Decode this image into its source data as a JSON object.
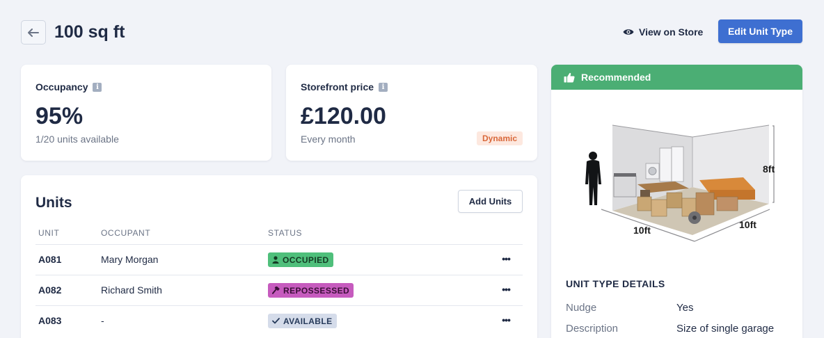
{
  "header": {
    "title": "100 sq ft",
    "view_on_store": "View on Store",
    "edit_button": "Edit Unit Type"
  },
  "occupancy": {
    "label": "Occupancy",
    "value": "95%",
    "sub": "1/20 units available"
  },
  "price": {
    "label": "Storefront price",
    "value": "£120.00",
    "sub": "Every month",
    "badge": "Dynamic"
  },
  "units": {
    "title": "Units",
    "add_button": "Add Units",
    "columns": [
      "UNIT",
      "OCCUPANT",
      "STATUS"
    ],
    "rows": [
      {
        "unit": "A081",
        "occupant": "Mary Morgan",
        "status": "OCCUPIED"
      },
      {
        "unit": "A082",
        "occupant": "Richard Smith",
        "status": "REPOSSESSED"
      },
      {
        "unit": "A083",
        "occupant": "-",
        "status": "AVAILABLE"
      }
    ],
    "more_glyph": "•••"
  },
  "recommended": {
    "header": "Recommended",
    "dims": {
      "height": "8ft",
      "width": "10ft",
      "depth": "10ft"
    },
    "details_title": "UNIT TYPE DETAILS",
    "details": [
      {
        "key": "Nudge",
        "value": "Yes"
      },
      {
        "key": "Description",
        "value": "Size of single garage"
      }
    ]
  },
  "colors": {
    "primary": "#3e6fd1",
    "recommended": "#4bae74",
    "occupied": "#4fbf7b",
    "repossessed": "#c65bbe",
    "available": "#d5dcea",
    "dynamic_badge_bg": "#fde8df",
    "dynamic_badge_text": "#d9683a"
  },
  "icons": {
    "back": "arrow-left-icon",
    "view": "eye-icon",
    "info": "info-icon",
    "recommended": "thumbs-up-icon",
    "occupied": "user-icon",
    "repossessed": "hammer-icon",
    "available": "check-icon",
    "more": "ellipsis-icon"
  }
}
